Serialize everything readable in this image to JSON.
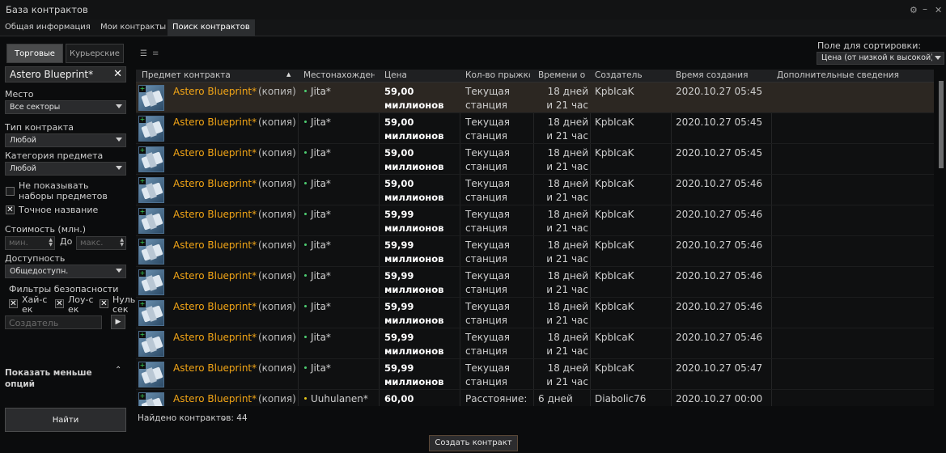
{
  "window": {
    "title": "База контрактов"
  },
  "tabs": [
    {
      "label": "Общая информация"
    },
    {
      "label": "Мои контракты"
    },
    {
      "label": "Поиск контрактов"
    }
  ],
  "left": {
    "segment_trade": "Торговые",
    "segment_courier": "Курьерские",
    "search_value": "Astero Blueprint*",
    "location_label": "Место",
    "location_value": "Все секторы",
    "contract_type_label": "Тип контракта",
    "contract_type_value": "Любой",
    "item_category_label": "Категория предмета",
    "item_category_value": "Любой",
    "hide_bundles_line1": "Не показывать",
    "hide_bundles_line2": "наборы предметов",
    "exact_name_label": "Точное название",
    "price_label": "Стоимость (млн.)",
    "min_placeholder": "мин.",
    "to_label": "До",
    "max_placeholder": "макс.",
    "availability_label": "Доступность",
    "availability_value": "Общедоступн.",
    "security_label": "Фильтры безопасности",
    "sec_high_1": "Хай-с",
    "sec_high_2": "ек",
    "sec_low_1": "Лоу-с",
    "sec_low_2": "ек",
    "sec_null_1": "Нуль-",
    "sec_null_2": "сек",
    "issuer_placeholder": "Создатель",
    "show_less_1": "Показать меньше",
    "show_less_2": "опций",
    "find_button": "Найти"
  },
  "sort": {
    "label": "Поле для сортировки:",
    "value": "Цена (от низкой к высокой)"
  },
  "columns": [
    "Предмет контракта",
    "Местонахождение",
    "Цена",
    "Кол-во прыжков",
    "Времени осталось",
    "Создатель",
    "Время создания",
    "Дополнительные сведения"
  ],
  "rows": [
    {
      "item": "Astero Blueprint*",
      "copy": "(копия)",
      "location": "Jita*",
      "sec_color": "#4ecf72",
      "price1": "59,00",
      "price2": "миллионов",
      "jumps1": "Текущая",
      "jumps2": "станция",
      "time1": "18 дней",
      "time2": "и 21 час",
      "issuer": "KpbIcaK",
      "created": "2020.10.27 05:45"
    },
    {
      "item": "Astero Blueprint*",
      "copy": "(копия)",
      "location": "Jita*",
      "sec_color": "#4ecf72",
      "price1": "59,00",
      "price2": "миллионов",
      "jumps1": "Текущая",
      "jumps2": "станция",
      "time1": "18 дней",
      "time2": "и 21 час",
      "issuer": "KpbIcaK",
      "created": "2020.10.27 05:45"
    },
    {
      "item": "Astero Blueprint*",
      "copy": "(копия)",
      "location": "Jita*",
      "sec_color": "#4ecf72",
      "price1": "59,00",
      "price2": "миллионов",
      "jumps1": "Текущая",
      "jumps2": "станция",
      "time1": "18 дней",
      "time2": "и 21 час",
      "issuer": "KpbIcaK",
      "created": "2020.10.27 05:45"
    },
    {
      "item": "Astero Blueprint*",
      "copy": "(копия)",
      "location": "Jita*",
      "sec_color": "#4ecf72",
      "price1": "59,00",
      "price2": "миллионов",
      "jumps1": "Текущая",
      "jumps2": "станция",
      "time1": "18 дней",
      "time2": "и 21 час",
      "issuer": "KpbIcaK",
      "created": "2020.10.27 05:46"
    },
    {
      "item": "Astero Blueprint*",
      "copy": "(копия)",
      "location": "Jita*",
      "sec_color": "#4ecf72",
      "price1": "59,99",
      "price2": "миллионов",
      "jumps1": "Текущая",
      "jumps2": "станция",
      "time1": "18 дней",
      "time2": "и 21 час",
      "issuer": "KpbIcaK",
      "created": "2020.10.27 05:46"
    },
    {
      "item": "Astero Blueprint*",
      "copy": "(копия)",
      "location": "Jita*",
      "sec_color": "#4ecf72",
      "price1": "59,99",
      "price2": "миллионов",
      "jumps1": "Текущая",
      "jumps2": "станция",
      "time1": "18 дней",
      "time2": "и 21 час",
      "issuer": "KpbIcaK",
      "created": "2020.10.27 05:46"
    },
    {
      "item": "Astero Blueprint*",
      "copy": "(копия)",
      "location": "Jita*",
      "sec_color": "#4ecf72",
      "price1": "59,99",
      "price2": "миллионов",
      "jumps1": "Текущая",
      "jumps2": "станция",
      "time1": "18 дней",
      "time2": "и 21 час",
      "issuer": "KpbIcaK",
      "created": "2020.10.27 05:46"
    },
    {
      "item": "Astero Blueprint*",
      "copy": "(копия)",
      "location": "Jita*",
      "sec_color": "#4ecf72",
      "price1": "59,99",
      "price2": "миллионов",
      "jumps1": "Текущая",
      "jumps2": "станция",
      "time1": "18 дней",
      "time2": "и 21 час",
      "issuer": "KpbIcaK",
      "created": "2020.10.27 05:46"
    },
    {
      "item": "Astero Blueprint*",
      "copy": "(копия)",
      "location": "Jita*",
      "sec_color": "#4ecf72",
      "price1": "59,99",
      "price2": "миллионов",
      "jumps1": "Текущая",
      "jumps2": "станция",
      "time1": "18 дней",
      "time2": "и 21 час",
      "issuer": "KpbIcaK",
      "created": "2020.10.27 05:46"
    },
    {
      "item": "Astero Blueprint*",
      "copy": "(копия)",
      "location": "Jita*",
      "sec_color": "#4ecf72",
      "price1": "59,99",
      "price2": "миллионов",
      "jumps1": "Текущая",
      "jumps2": "станция",
      "time1": "18 дней",
      "time2": "и 21 час",
      "issuer": "KpbIcaK",
      "created": "2020.10.27 05:47"
    },
    {
      "item": "Astero Blueprint*",
      "copy": "(копия)",
      "location": "Uuhulanen*",
      "sec_color": "#e6c619",
      "price1": "60,00",
      "price2": "",
      "jumps1": "Расстояние:",
      "jumps2": "",
      "time1": "6 дней",
      "time2": "",
      "issuer": "Diabolic76",
      "created": "2020.10.27 00:00"
    }
  ],
  "footer": {
    "found": "Найдено контрактов: 44",
    "create_button": "Создать контракт"
  },
  "colors": {
    "accent_orange": "#f2a516",
    "highsec": "#4ecf72",
    "lowsec": "#e6c619",
    "selected_row": "#2c2722"
  }
}
